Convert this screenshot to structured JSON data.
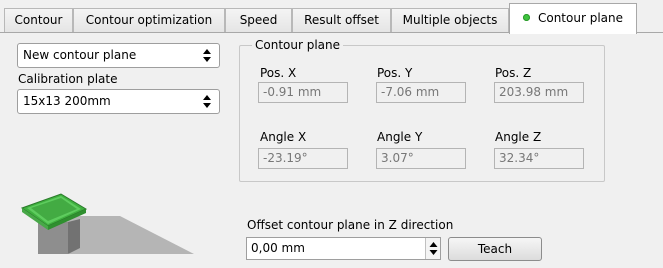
{
  "tabs": [
    {
      "label": "Contour"
    },
    {
      "label": "Contour optimization"
    },
    {
      "label": "Speed"
    },
    {
      "label": "Result offset"
    },
    {
      "label": "Multiple objects"
    },
    {
      "label": "Contour plane"
    }
  ],
  "active_tab_index": 5,
  "plane_select": {
    "value": "New contour plane"
  },
  "calibration": {
    "label": "Calibration plate",
    "value": "15x13 200mm"
  },
  "group": {
    "title": "Contour plane",
    "pos_x": {
      "label": "Pos. X",
      "value": "-0.91 mm"
    },
    "pos_y": {
      "label": "Pos. Y",
      "value": "-7.06 mm"
    },
    "pos_z": {
      "label": "Pos. Z",
      "value": "203.98 mm"
    },
    "angle_x": {
      "label": "Angle X",
      "value": "-23.19°"
    },
    "angle_y": {
      "label": "Angle Y",
      "value": "3.07°"
    },
    "angle_z": {
      "label": "Angle Z",
      "value": "32.34°"
    }
  },
  "offset": {
    "label": "Offset contour plane in Z direction",
    "value": "0,00 mm"
  },
  "teach_button": {
    "label": "Teach"
  },
  "colors": {
    "status_dot": "#3ec43e",
    "plate_green": "#4bb84b"
  },
  "icons": {
    "status": "green-dot-icon",
    "illustration": "calibration-plate-illustration"
  }
}
